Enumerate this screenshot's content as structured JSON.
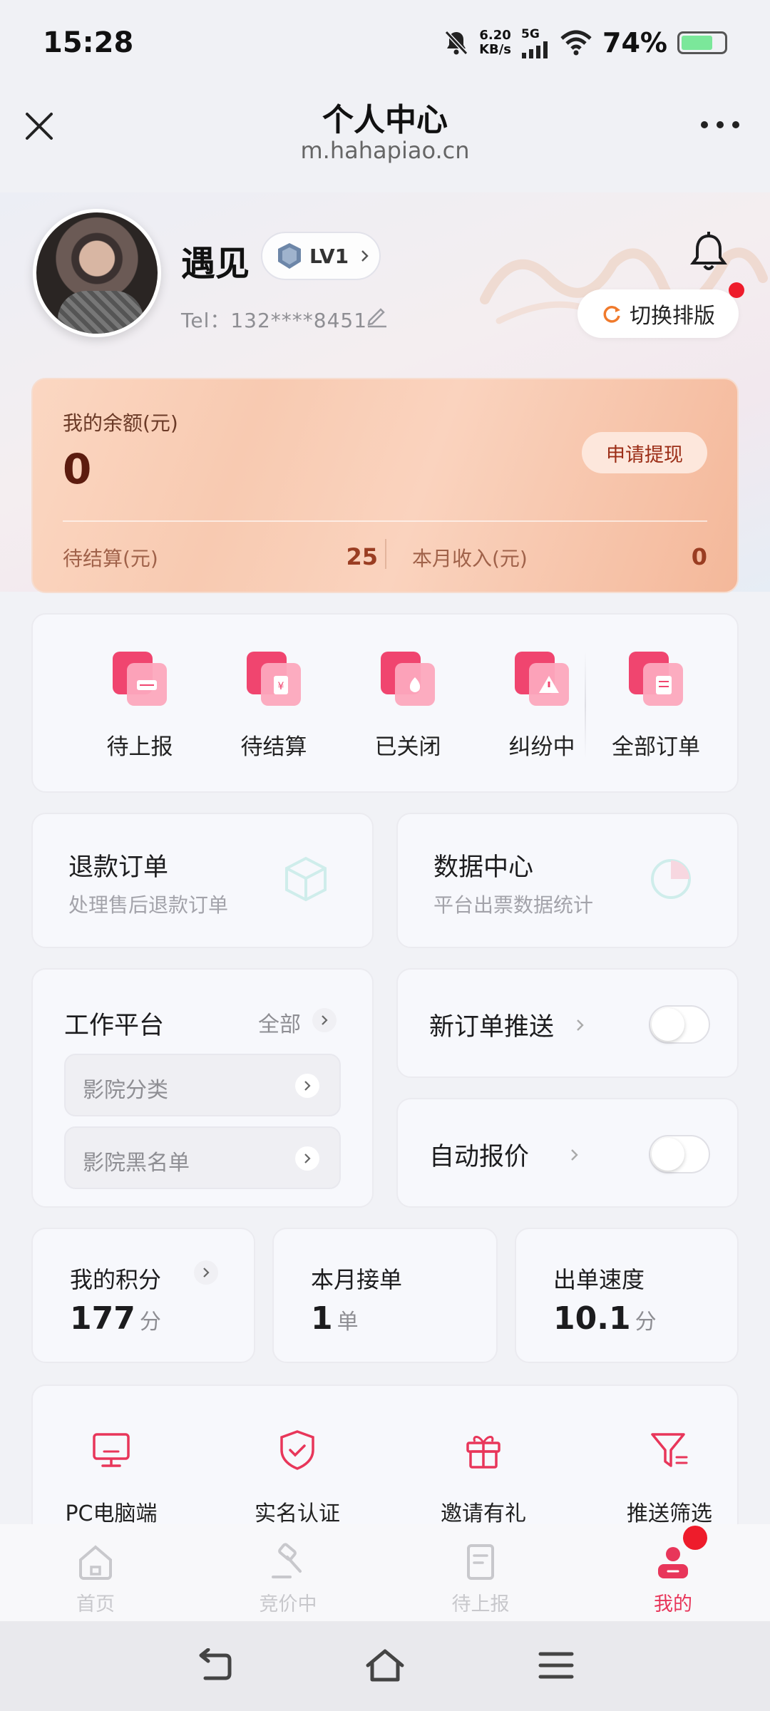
{
  "status_bar": {
    "time": "15:28",
    "net_speed_value": "6.20",
    "net_speed_unit": "KB/s",
    "network": "5G",
    "battery_percent": "74%",
    "battery_level": 0.74
  },
  "nav": {
    "title": "个人中心",
    "subtitle": "m.hahapiao.cn"
  },
  "profile": {
    "name": "遇见",
    "level": "LV1",
    "tel": "Tel：132****8451",
    "switch_layout_label": "切换排版"
  },
  "balance": {
    "label": "我的余额(元)",
    "value": "0",
    "withdraw_label": "申请提现",
    "pending_label": "待结算(元)",
    "pending_value": "25",
    "month_income_label": "本月收入(元)",
    "month_income_value": "0"
  },
  "orders": [
    {
      "label": "待上报",
      "icon": "report-icon"
    },
    {
      "label": "待结算",
      "icon": "settlement-icon"
    },
    {
      "label": "已关闭",
      "icon": "closed-icon"
    },
    {
      "label": "纠纷中",
      "icon": "dispute-icon"
    },
    {
      "label": "全部订单",
      "icon": "all-orders-icon"
    }
  ],
  "services": {
    "refund": {
      "title": "退款订单",
      "subtitle": "处理售后退款订单"
    },
    "data_center": {
      "title": "数据中心",
      "subtitle": "平台出票数据统计"
    }
  },
  "work_platform": {
    "title": "工作平台",
    "all_label": "全部",
    "items": [
      {
        "label": "影院分类"
      },
      {
        "label": "影院黑名单"
      }
    ]
  },
  "toggles": {
    "new_order_push": {
      "label": "新订单推送",
      "enabled": false
    },
    "auto_quote": {
      "label": "自动报价",
      "enabled": false
    }
  },
  "stats": {
    "points": {
      "label": "我的积分",
      "value": "177",
      "unit": "分"
    },
    "monthly_orders": {
      "label": "本月接单",
      "value": "1",
      "unit": "单"
    },
    "speed": {
      "label": "出单速度",
      "value": "10.1",
      "unit": "分"
    }
  },
  "tools": [
    {
      "label": "PC电脑端",
      "icon": "monitor-icon"
    },
    {
      "label": "实名认证",
      "icon": "shield-check-icon"
    },
    {
      "label": "邀请有礼",
      "icon": "gift-icon"
    },
    {
      "label": "推送筛选",
      "icon": "filter-icon"
    }
  ],
  "tabbar": [
    {
      "label": "首页",
      "icon": "home-icon",
      "active": false
    },
    {
      "label": "竞价中",
      "icon": "auction-hammer-icon",
      "active": false
    },
    {
      "label": "待上报",
      "icon": "document-icon",
      "active": false
    },
    {
      "label": "我的",
      "icon": "user-icon",
      "active": true
    }
  ],
  "colors": {
    "accent": "#e8365a",
    "badge_red": "#ee1c2b",
    "balance_card": "#f8cab1"
  }
}
